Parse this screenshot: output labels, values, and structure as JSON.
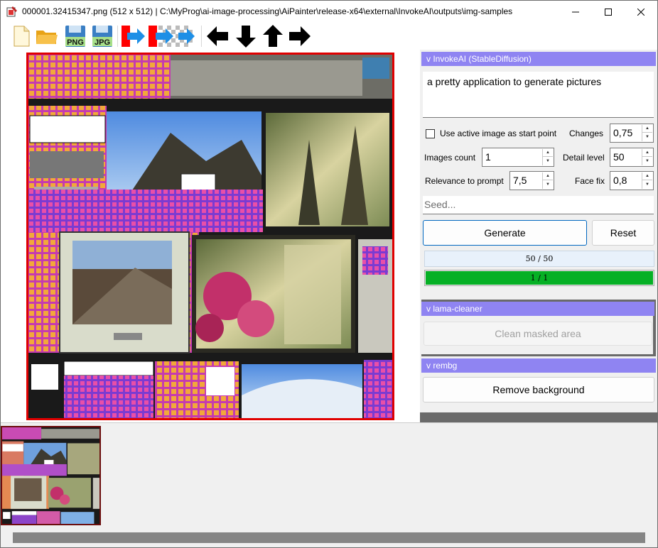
{
  "window": {
    "title": "000001.32415347.png (512 x 512) | C:\\MyProg\\ai-image-processing\\AiPainter\\release-x64\\external\\InvokeAI\\outputs\\img-samples"
  },
  "toolbar": {
    "icons": [
      "new-file-icon",
      "open-folder-icon",
      "save-png-icon",
      "save-jpg-icon",
      "apply-mask-icon",
      "clear-mask-icon",
      "arrow-left-icon",
      "arrow-down-icon",
      "arrow-up-icon",
      "arrow-right-icon"
    ],
    "png_label": "PNG",
    "jpg_label": "JPG"
  },
  "invokeai": {
    "header": "v InvokeAI (StableDiffusion)",
    "prompt": "a pretty application to generate pictures",
    "use_active_image_label": "Use active image as start point",
    "changes_label": "Changes",
    "changes_value": "0,75",
    "images_count_label": "Images count",
    "images_count_value": "1",
    "detail_level_label": "Detail level",
    "detail_level_value": "50",
    "relevance_label": "Relevance to prompt",
    "relevance_value": "7,5",
    "face_fix_label": "Face fix",
    "face_fix_value": "0,8",
    "seed_placeholder": "Seed...",
    "generate_label": "Generate",
    "reset_label": "Reset",
    "steps_progress_text": "50 / 50",
    "steps_progress": 1.0,
    "images_progress_text": "1 / 1",
    "images_progress": 1.0
  },
  "lama": {
    "header": "v lama-cleaner",
    "clean_label": "Clean masked area"
  },
  "rembg": {
    "header": "v rembg",
    "remove_label": "Remove background"
  },
  "colors": {
    "section_header": "#8f84f2",
    "progress_fill": "#06b025",
    "image_border": "#e00000"
  }
}
